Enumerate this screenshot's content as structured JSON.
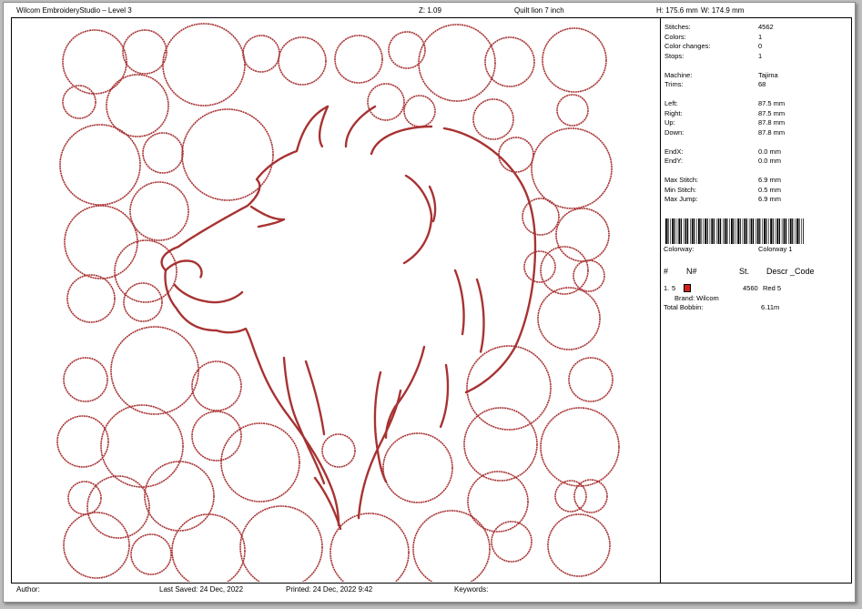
{
  "header": {
    "app_title": "Wilcom EmbroideryStudio – Level 3",
    "zoom": "Z: 1.09",
    "design_name": "Quilt lion 7 inch",
    "height_label": "H: 175.6 mm",
    "width_label": "W: 174.9 mm"
  },
  "stats": {
    "rows": [
      {
        "label": "Stitches:",
        "value": "4562"
      },
      {
        "label": "Colors:",
        "value": "1"
      },
      {
        "label": "Color changes:",
        "value": "0"
      },
      {
        "label": "Stops:",
        "value": "1"
      },
      null,
      {
        "label": "Machine:",
        "value": "Tajima"
      },
      {
        "label": "Trims:",
        "value": "68"
      },
      null,
      {
        "label": "Left:",
        "value": "87.5 mm"
      },
      {
        "label": "Right:",
        "value": "87.5 mm"
      },
      {
        "label": "Up:",
        "value": "87.8 mm"
      },
      {
        "label": "Down:",
        "value": "87.8 mm"
      },
      null,
      {
        "label": "EndX:",
        "value": "0.0 mm"
      },
      {
        "label": "EndY:",
        "value": "0.0 mm"
      },
      null,
      {
        "label": "Max Stitch:",
        "value": "6.9 mm"
      },
      {
        "label": "Min Stitch:",
        "value": "0.5 mm"
      },
      {
        "label": "Max Jump:",
        "value": "6.9 mm"
      }
    ]
  },
  "colorway": {
    "label": "Colorway:",
    "value": "Colorway 1"
  },
  "color_table": {
    "col_index": "#",
    "col_needle": "N#",
    "col_stitches": "St.",
    "col_desc": "Descr _Code",
    "rows": [
      {
        "index": "1.",
        "needle": "5",
        "swatch_color": "#d0201e",
        "stitches": "4560",
        "desc": "Red 5",
        "brand": "Brand: Wilcom"
      }
    ],
    "bobbin_label": "Total Bobbin:",
    "bobbin_value": "6.11m"
  },
  "footer": {
    "author": "Author:",
    "last_saved": "Last Saved: 24 Dec, 2022",
    "printed": "Printed: 24 Dec, 2022  9:42",
    "keywords": "Keywords:"
  },
  "colors": {
    "thread": "#a83232",
    "thread_light": "#c24a4a"
  }
}
